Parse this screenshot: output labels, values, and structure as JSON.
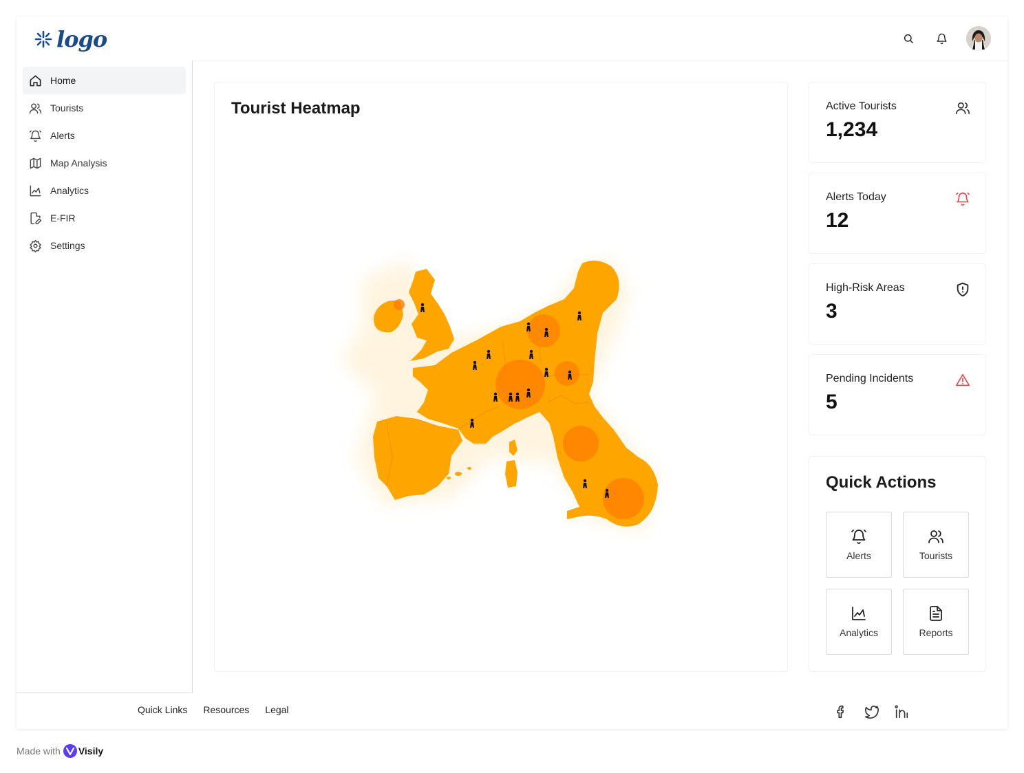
{
  "header": {
    "logo_text": "logo",
    "icons": [
      "search-icon",
      "bell-icon"
    ],
    "avatar": "user-avatar"
  },
  "sidebar": {
    "items": [
      {
        "label": "Home",
        "icon": "home-icon",
        "active": true
      },
      {
        "label": "Tourists",
        "icon": "users-icon"
      },
      {
        "label": "Alerts",
        "icon": "bell-ring-icon"
      },
      {
        "label": "Map Analysis",
        "icon": "map-icon"
      },
      {
        "label": "Analytics",
        "icon": "chart-icon"
      },
      {
        "label": "E-FIR",
        "icon": "file-pen-icon"
      },
      {
        "label": "Settings",
        "icon": "gear-icon"
      }
    ]
  },
  "main": {
    "heatmap": {
      "title": "Tourist Heatmap"
    }
  },
  "stats": [
    {
      "label": "Active Tourists",
      "value": "1,234",
      "icon": "users-icon",
      "color": "#333333"
    },
    {
      "label": "Alerts Today",
      "value": "12",
      "icon": "bell-ring-icon",
      "color": "#e5484d"
    },
    {
      "label": "High-Risk Areas",
      "value": "3",
      "icon": "shield-alert-icon",
      "color": "#222222"
    },
    {
      "label": "Pending Incidents",
      "value": "5",
      "icon": "triangle-alert-icon",
      "color": "#e5484d"
    }
  ],
  "quick_actions": {
    "title": "Quick Actions",
    "buttons": [
      {
        "label": "Alerts",
        "icon": "bell-ring-icon"
      },
      {
        "label": "Tourists",
        "icon": "users-icon"
      },
      {
        "label": "Analytics",
        "icon": "chart-icon"
      },
      {
        "label": "Reports",
        "icon": "file-text-icon"
      }
    ]
  },
  "footer": {
    "links": [
      "Quick Links",
      "Resources",
      "Legal"
    ],
    "social": [
      "facebook-icon",
      "twitter-icon",
      "linkedin-icon"
    ]
  },
  "made_with": {
    "text": "Made with",
    "brand": "Visily"
  },
  "colors": {
    "map_orange": "#ffa500",
    "hotspot": "#ff7f00",
    "accent_blue": "#1b4a8c",
    "alert_red": "#e5484d"
  }
}
